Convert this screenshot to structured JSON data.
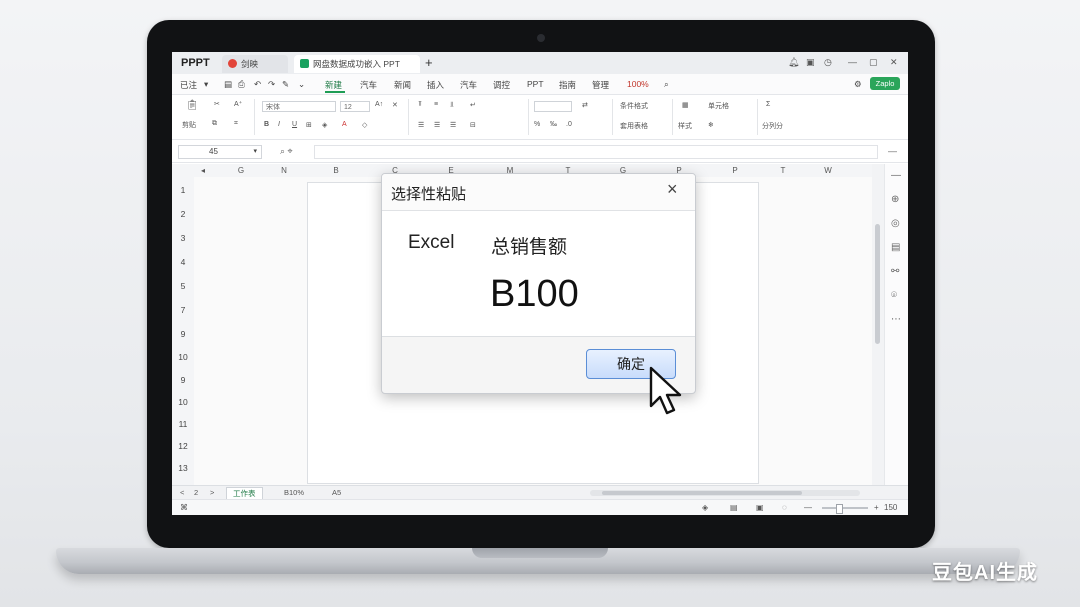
{
  "colors": {
    "accent": "#1f9d55",
    "dialog_button_border": "#5b8ed6",
    "tab_icon_red": "#e2453a",
    "tab_icon_green": "#1aa260"
  },
  "tabbar": {
    "app_name": "PPPT",
    "tab1_label": "剑映",
    "tab2_label": "网盘数据成功嵌入 PPT",
    "new_tab": "+"
  },
  "menubar": {
    "first": "已注",
    "items": [
      "新建",
      "汽车",
      "新闻",
      "插入",
      "汽车",
      "调控",
      "PPT",
      "指南",
      "管理"
    ],
    "zoom": "100%",
    "share": "Zaplo"
  },
  "ribbon": {
    "font_name": "宋体",
    "font_size": "12",
    "paste_label": "剪贴",
    "format_label": "样式",
    "style_labels": [
      "条件格式",
      "套用表格",
      "单元格",
      "分列分"
    ]
  },
  "formula_bar": {
    "cell_ref": "45"
  },
  "columns": [
    "G",
    "N",
    "B",
    "C",
    "E",
    "M",
    "T",
    "G",
    "P",
    "P",
    "T",
    "W"
  ],
  "rows": [
    "1",
    "2",
    "3",
    "4",
    "5",
    "7",
    "9",
    "10",
    "9",
    "10",
    "11",
    "12",
    "13"
  ],
  "sheet_tabs": {
    "nav_prev": "<",
    "page": "2",
    "nav_next": ">",
    "active": "工作表",
    "second": "B10%",
    "third": "A5"
  },
  "status": {
    "zoom": "150"
  },
  "dialog": {
    "title": "选择性粘贴",
    "close": "×",
    "label": "Excel",
    "heading": "总销售额",
    "value": "B100",
    "confirm": "确定"
  },
  "icons": [
    "close-icon",
    "search-icon",
    "plus-icon",
    "chevron-down-icon",
    "cursor-arrow-icon"
  ],
  "watermark": "豆包AI生成"
}
